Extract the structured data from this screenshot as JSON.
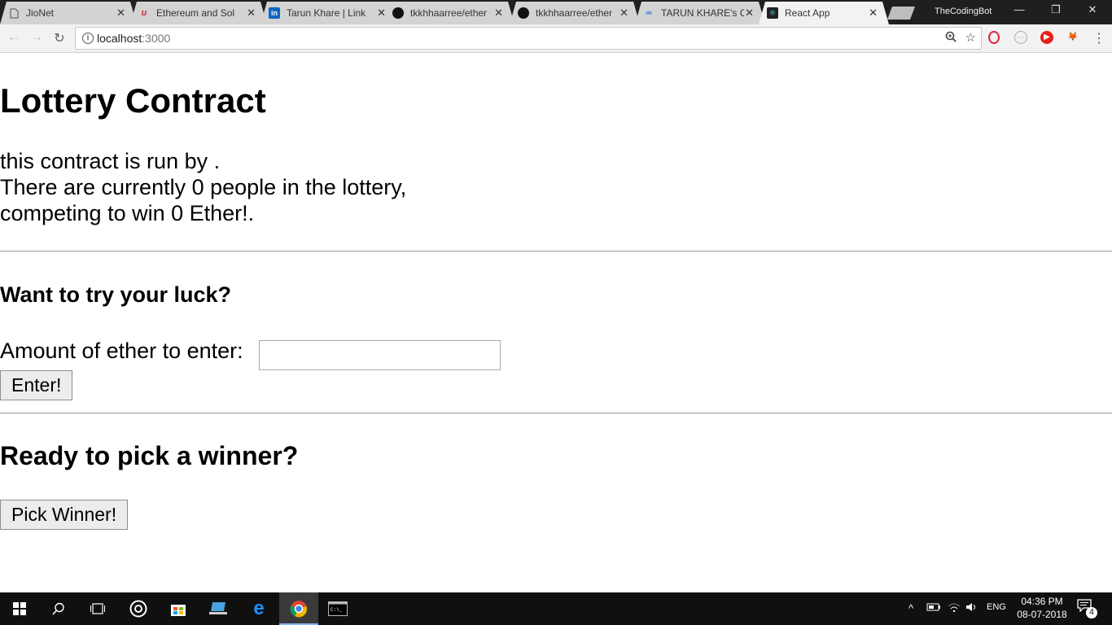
{
  "browser": {
    "tabs": [
      {
        "title": "JioNet",
        "icon": "page-icon"
      },
      {
        "title": "Ethereum and Sol",
        "icon": "udemy-icon"
      },
      {
        "title": "Tarun Khare | Link",
        "icon": "linkedin-icon"
      },
      {
        "title": "tkkhhaarree/ether",
        "icon": "github-icon"
      },
      {
        "title": "tkkhhaarree/ether",
        "icon": "github-icon"
      },
      {
        "title": "TARUN KHARE's C",
        "icon": "codechef-icon"
      },
      {
        "title": "React App",
        "icon": "react-icon",
        "active": true
      }
    ],
    "profile_name": "TheCodingBot",
    "url_host": "localhost",
    "url_port": ":3000",
    "window_controls": {
      "minimize": "—",
      "restore": "❐",
      "close": "✕"
    }
  },
  "page": {
    "title": "Lottery Contract",
    "intro_line1": "this contract is run by .",
    "intro_line2": "There are currently 0 people in the lottery,",
    "intro_line3": "competing to win 0 Ether!.",
    "enter_heading": "Want to try your luck?",
    "amount_label": "Amount of ether to enter: ",
    "amount_value": "",
    "enter_button": "Enter!",
    "pick_heading": "Ready to pick a winner?",
    "pick_button": "Pick Winner!"
  },
  "taskbar": {
    "language": "ENG",
    "time": "04:36 PM",
    "date": "08-07-2018",
    "notification_count": "4"
  },
  "colors": {
    "tab_bar": "#1f1f1f",
    "active_tab": "#f2f2f2",
    "inactive_tab": "#d3d3d3",
    "taskbar": "#101010"
  }
}
